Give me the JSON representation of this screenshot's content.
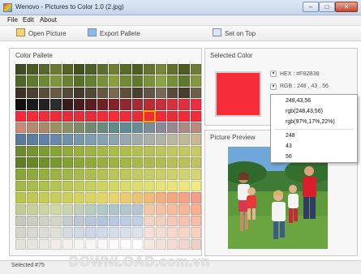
{
  "window": {
    "title": "Wenovo - Pictures to Color 1.0 (2.jpg)"
  },
  "menu": [
    "File",
    "Edit",
    "About"
  ],
  "toolbar": {
    "open": "Open Picture",
    "export": "Export Pallete",
    "ontop": "Set on Top"
  },
  "palette": {
    "title": "Color Pallete",
    "selected_index": 75,
    "rows": [
      [
        "#3e4a20",
        "#4a5a25",
        "#56682a",
        "#6b7a30",
        "#546325",
        "#3f5220",
        "#4a5f2a",
        "#5c6e30",
        "#6f7f35",
        "#5a6a28",
        "#4d5e22",
        "#627530",
        "#76873a",
        "#5f702d",
        "#4b5b22",
        "#6c7e35"
      ],
      [
        "#4d6625",
        "#5e7a2c",
        "#6d8a33",
        "#80963a",
        "#6a8230",
        "#577128",
        "#65802f",
        "#789038",
        "#8aa040",
        "#708a34",
        "#5f7a2c",
        "#7a9238",
        "#8ea444",
        "#739036",
        "#5f792c",
        "#82993d"
      ],
      [
        "#3c3326",
        "#4c4030",
        "#5a4d3a",
        "#6a5a44",
        "#57493a",
        "#453a2e",
        "#544838",
        "#665744",
        "#786a50",
        "#5d4f3c",
        "#4a3f30",
        "#63554a",
        "#776a5a",
        "#5a4a3c",
        "#4a3c30",
        "#6e5f4c"
      ],
      [
        "#101010",
        "#1a1a1a",
        "#222222",
        "#2c2c2c",
        "#3a1a1c",
        "#4a1c20",
        "#5a1e22",
        "#6e2024",
        "#80242a",
        "#902830",
        "#a32b33",
        "#b52e37",
        "#c5303a",
        "#d4313d",
        "#e02f3e",
        "#ec2e40"
      ],
      [
        "#f82838",
        "#f52b38",
        "#f02d3a",
        "#ee2c39",
        "#eb2a38",
        "#e82b38",
        "#e52c39",
        "#f22a39",
        "#f82b38",
        "#ef2c3a",
        "#e92a37",
        "#f02b39",
        "#f52a38",
        "#e82c38",
        "#f12b39",
        "#f62b38"
      ],
      [
        "#c98a7a",
        "#b68a6e",
        "#a88866",
        "#9a9060",
        "#8c9065",
        "#7f8a6a",
        "#728872",
        "#6a8a7c",
        "#628a88",
        "#5f8c94",
        "#6a8a98",
        "#7a8c9a",
        "#8a8a98",
        "#9a8890",
        "#aa8a88",
        "#b98a80"
      ],
      [
        "#5a7a98",
        "#5e7ea0",
        "#6282a6",
        "#6a88aa",
        "#7090ae",
        "#7896b0",
        "#809cb2",
        "#88a0b2",
        "#90a4b0",
        "#98a8ae",
        "#a0acac",
        "#a8b0a8",
        "#b0b4a4",
        "#b8b69e",
        "#c0b898",
        "#c8b892"
      ],
      [
        "#6d8a2e",
        "#769430",
        "#7f9c34",
        "#88a438",
        "#90aa3c",
        "#98b040",
        "#9fb444",
        "#a6b848",
        "#acbc4c",
        "#b0be50",
        "#b4c054",
        "#b8c258",
        "#bcc45c",
        "#c0c660",
        "#c4c864",
        "#c8ca68"
      ],
      [
        "#5f7d28",
        "#688628",
        "#718f2c",
        "#7a9830",
        "#82a034",
        "#8aa638",
        "#91aa3c",
        "#98ae40",
        "#9eb244",
        "#a4b548",
        "#a9b84c",
        "#aeba50",
        "#b2bc54",
        "#b6be58",
        "#bac05c",
        "#bec260"
      ],
      [
        "#88a43a",
        "#8eaa3e",
        "#94ae42",
        "#9ab246",
        "#a0b64a",
        "#a6ba4e",
        "#acbe52",
        "#b2c256",
        "#b8c65a",
        "#bec85e",
        "#c2ca62",
        "#c6cc66",
        "#cace6a",
        "#ced06e",
        "#d2d272",
        "#d6d476"
      ],
      [
        "#a2b848",
        "#a8bc4c",
        "#aec050",
        "#b4c454",
        "#bac858",
        "#c0cc5c",
        "#c6d060",
        "#ccd464",
        "#d2d868",
        "#d8dc6c",
        "#dcde70",
        "#e0e074",
        "#e4e278",
        "#e8e47c",
        "#ece680",
        "#f0e884"
      ],
      [
        "#b8c64e",
        "#bec852",
        "#c4cb56",
        "#cacd5a",
        "#d0cf5e",
        "#d6d162",
        "#dcd366",
        "#e2d56a",
        "#e8d46e",
        "#eccb72",
        "#eec276",
        "#f0b97a",
        "#f2b07e",
        "#f4a882",
        "#f5a286",
        "#f69c8a"
      ],
      [
        "#c4cc96",
        "#c8d09c",
        "#ccd4a2",
        "#d0d8a8",
        "#c8d4b0",
        "#c0d0b8",
        "#b8ccc0",
        "#b0c8c8",
        "#b0c4cc",
        "#b4c4d0",
        "#b8c4d4",
        "#f2c8a8",
        "#f4c2a2",
        "#f6bc9c",
        "#f7b696",
        "#f8b090"
      ],
      [
        "#c8c8bc",
        "#ccccc0",
        "#d0d0c4",
        "#d4d4c8",
        "#c4ccd0",
        "#bcc8d4",
        "#b8c6d8",
        "#b4c4dc",
        "#b8c8e0",
        "#bccce2",
        "#c0d0e4",
        "#f0d4c4",
        "#f2cebe",
        "#f4c8b8",
        "#f6c2b2",
        "#f8bcac"
      ],
      [
        "#d4d4cc",
        "#d8d8d0",
        "#dcdcd4",
        "#e0e0d8",
        "#d4dae0",
        "#d0d8e4",
        "#ccd6e8",
        "#d0dae8",
        "#d4dde8",
        "#d8e0ea",
        "#dce3ec",
        "#f2e0d8",
        "#f4dcd2",
        "#f6d8cc",
        "#f7d4c6",
        "#f8d0c0"
      ],
      [
        "#e4e0dc",
        "#e8e4e0",
        "#ece8e4",
        "#f0ece8",
        "#f4f0ec",
        "#f6f4f0",
        "#f8f6f4",
        "#faf8f6",
        "#fcfaf8",
        "#fdfcfb",
        "#fefefe",
        "#f6e8e0",
        "#f4e2da",
        "#f2dcd4",
        "#f0d6ce",
        "#eed0c8"
      ]
    ]
  },
  "selected": {
    "title": "Selected Color",
    "hex_label": "HEX : #F82B38",
    "rgb_label": "RGB : 248 , 43 , 56",
    "color": "#f82b38",
    "formats": [
      "248,43,56",
      "rgb(248,43,56)",
      "rgb(97%,17%,22%)",
      "248",
      "43",
      "56"
    ]
  },
  "preview": {
    "title": "Picture Preview"
  },
  "status": {
    "text": "Selected #75"
  },
  "watermark": "DOWNLOAD.com.vn"
}
